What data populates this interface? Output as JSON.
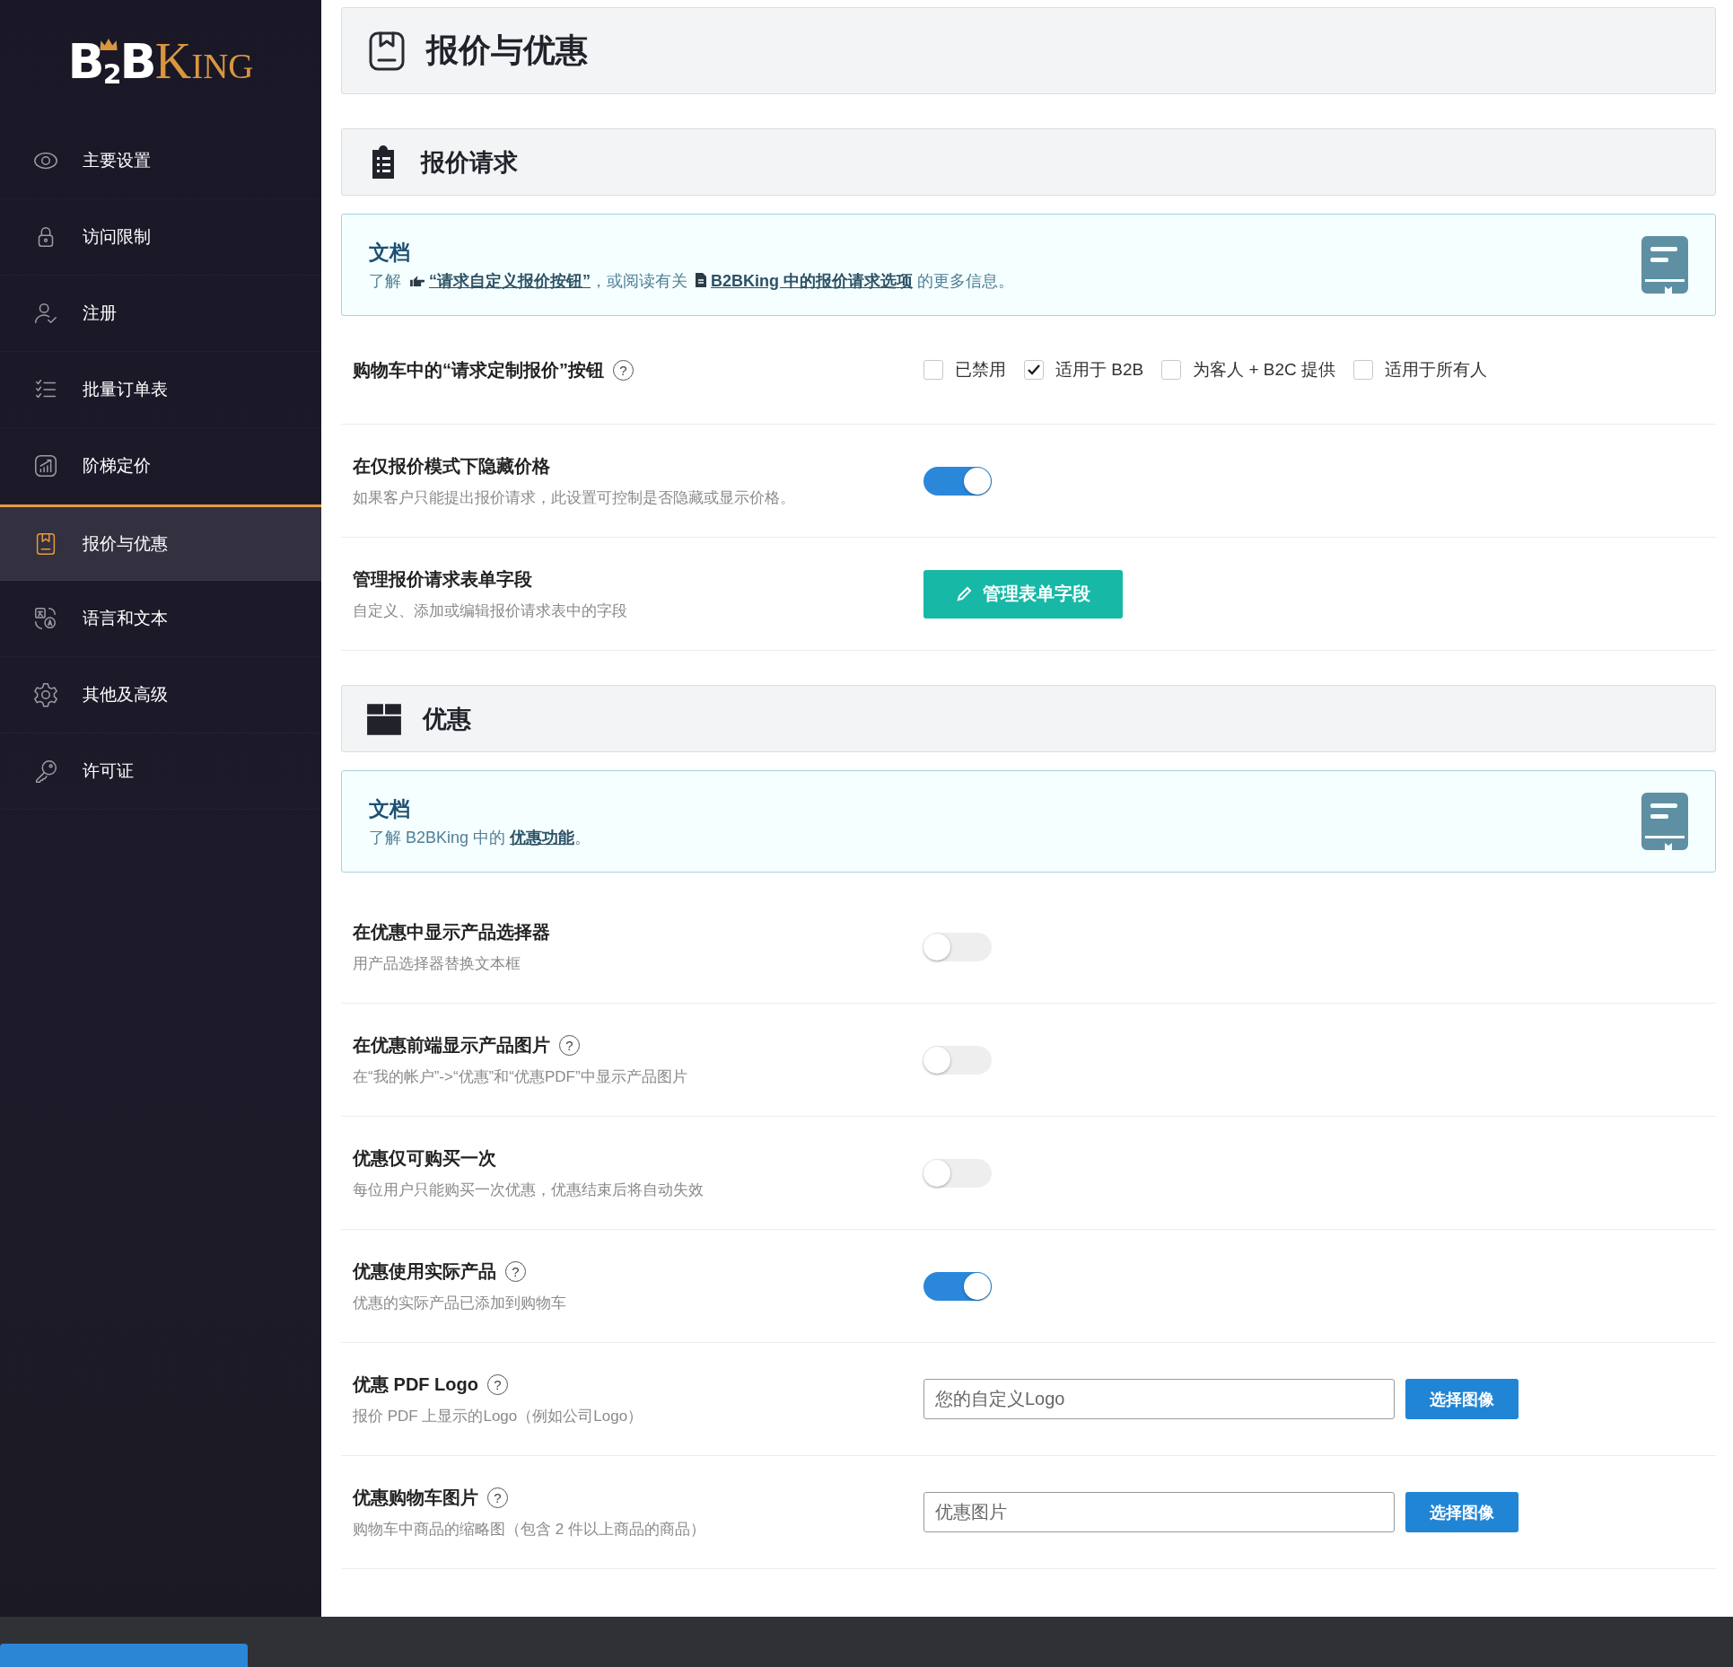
{
  "logo": {
    "main": "B$_{2}$B",
    "accent": "King"
  },
  "sidebar": {
    "items": [
      {
        "label": "主要设置",
        "selected": false
      },
      {
        "label": "访问限制",
        "selected": false
      },
      {
        "label": "注册",
        "selected": false
      },
      {
        "label": "批量订单表",
        "selected": false
      },
      {
        "label": "阶梯定价",
        "selected": false
      },
      {
        "label": "报价与优惠",
        "selected": true
      },
      {
        "label": "语言和文本",
        "selected": false
      },
      {
        "label": "其他及高级",
        "selected": false
      },
      {
        "label": "许可证",
        "selected": false
      }
    ]
  },
  "page": {
    "title": "报价与优惠"
  },
  "sections": [
    {
      "title": "报价请求",
      "doc": {
        "heading": "文档",
        "parts": [
          {
            "kind": "text",
            "text": "了解 "
          },
          {
            "kind": "hand_link",
            "text": "“请求自定义报价按钮”"
          },
          {
            "kind": "text",
            "text": "，或阅读有关 "
          },
          {
            "kind": "file_link",
            "text": "B2BKing 中的报价请求选项"
          },
          {
            "kind": "text",
            "text": " 的更多信息。"
          }
        ]
      },
      "rows": [
        {
          "kind": "checkboxes",
          "title": "购物车中的“请求定制报价”按钮",
          "help": "?",
          "options": [
            {
              "label": "已禁用",
              "checked": false
            },
            {
              "label": "适用于 B2B",
              "checked": true
            },
            {
              "label": "为客人 + B2C 提供",
              "checked": false
            },
            {
              "label": "适用于所有人",
              "checked": false
            }
          ]
        },
        {
          "kind": "toggle",
          "title": "在仅报价模式下隐藏价格",
          "description": "如果客户只能提出报价请求，此设置可控制是否隐藏或显示价格。",
          "on": true
        },
        {
          "kind": "button",
          "title": "管理报价请求表单字段",
          "description": "自定义、添加或编辑报价请求表中的字段",
          "button": "管理表单字段"
        }
      ]
    },
    {
      "title": "优惠",
      "doc": {
        "heading": "文档",
        "parts": [
          {
            "kind": "text",
            "text": "了解 B2BKing 中的 "
          },
          {
            "kind": "link",
            "text": "优惠功能"
          },
          {
            "kind": "text",
            "text": "。"
          }
        ]
      },
      "rows": [
        {
          "kind": "toggle",
          "title": "在优惠中显示产品选择器",
          "description": "用产品选择器替换文本框",
          "on": false
        },
        {
          "kind": "toggle",
          "title": "在优惠前端显示产品图片",
          "help": "?",
          "description": "在“我的帐户”->“优惠”和“优惠PDF”中显示产品图片",
          "on": false
        },
        {
          "kind": "toggle",
          "title": "优惠仅可购买一次",
          "description": "每位用户只能购买一次优惠，优惠结束后将自动失效",
          "on": false
        },
        {
          "kind": "toggle",
          "title": "优惠使用实际产品",
          "help": "?",
          "description": "优惠的实际产品已添加到购物车",
          "on": true
        },
        {
          "kind": "file",
          "title": "优惠 PDF Logo",
          "help": "?",
          "description": "报价 PDF 上显示的Logo（例如公司Logo）",
          "placeholder": "您的自定义Logo",
          "button": "选择图像"
        },
        {
          "kind": "file",
          "title": "优惠购物车图片",
          "help": "?",
          "description": "购物车中商品的缩略图（包含 2 件以上商品的商品）",
          "placeholder": "优惠图片",
          "button": "选择图像"
        }
      ]
    }
  ]
}
